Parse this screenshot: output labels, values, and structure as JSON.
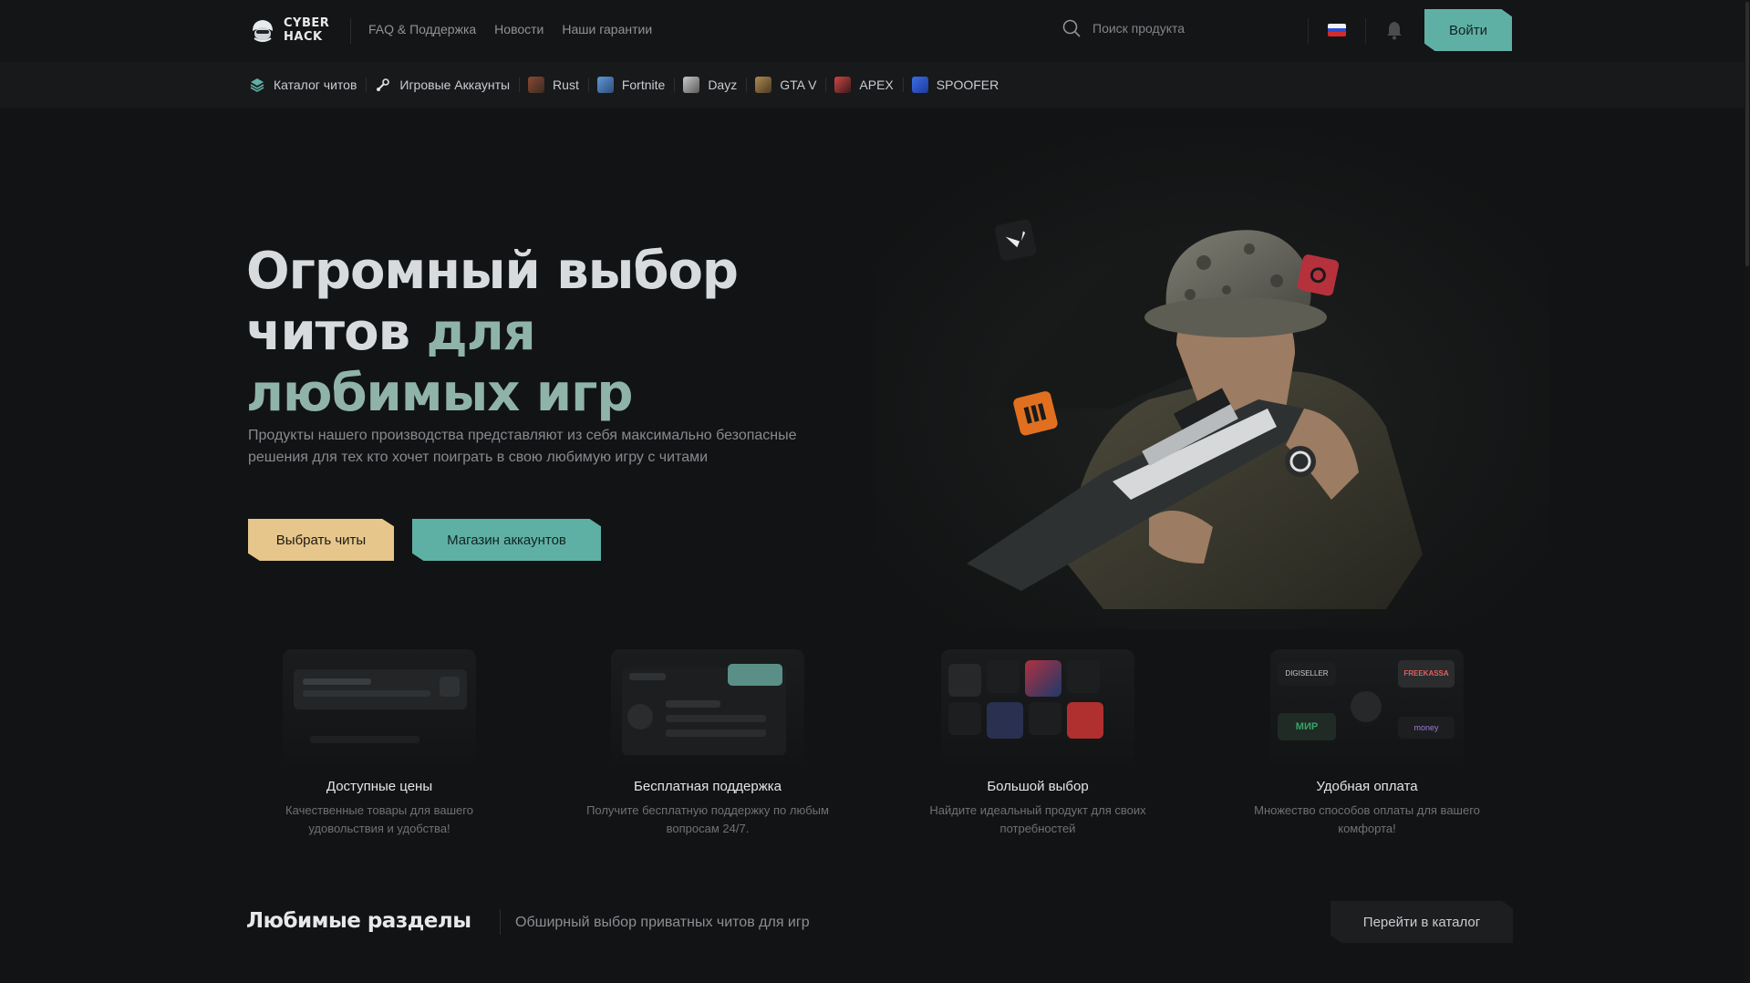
{
  "brand": {
    "line1": "CYBER",
    "line2": "HACK"
  },
  "topnav": [
    {
      "label": "FAQ & Поддержка"
    },
    {
      "label": "Новости"
    },
    {
      "label": "Наши гарантии"
    }
  ],
  "search": {
    "placeholder": "Поиск продукта"
  },
  "header": {
    "login_label": "Войти",
    "language_flag": "ru-flag-icon"
  },
  "catnav": [
    {
      "label": "Каталог читов",
      "icon": "layers-icon",
      "color": "#5fb0a4"
    },
    {
      "label": "Игровые Аккаунты",
      "icon": "steam-icon",
      "color": "#e0e0e0"
    },
    {
      "label": "Rust",
      "icon": "rust-icon",
      "color": "#7a3d2a"
    },
    {
      "label": "Fortnite",
      "icon": "fortnite-icon",
      "color": "#4a7fb8"
    },
    {
      "label": "Dayz",
      "icon": "dayz-icon",
      "color": "#9a9a9a"
    },
    {
      "label": "GTA V",
      "icon": "gta-icon",
      "color": "#8a6b3e"
    },
    {
      "label": "APEX",
      "icon": "apex-icon",
      "color": "#b03a3a"
    },
    {
      "label": "SPOOFER",
      "icon": "spoofer-icon",
      "color": "#2f5fd0"
    }
  ],
  "hero": {
    "title_line1": "Огромный выбор",
    "title_line2a": "читов ",
    "title_line2b": "для",
    "title_line3": "любимых игр",
    "subtitle": "Продукты нашего производства представляют из себя максимально безопасные решения для тех кто хочет поиграть в свою любимую игру с читами",
    "btn_primary": "Выбрать читы",
    "btn_secondary": "Магазин аккаунтов"
  },
  "features": [
    {
      "title": "Доступные цены",
      "desc": "Качественные товары для вашего удовольствия и удобства!"
    },
    {
      "title": "Бесплатная поддержка",
      "desc": "Получите бесплатную поддержку по любым вопросам 24/7."
    },
    {
      "title": "Большой выбор",
      "desc": "Найдите идеальный продукт для своих потребностей"
    },
    {
      "title": "Удобная оплата",
      "desc": "Множество способов оплаты для вашего комфорта!"
    }
  ],
  "payments": {
    "digiseller": "DIGISELLER",
    "freekassa": "FREEKASSA",
    "mir": "МИР",
    "yoomoney": "money"
  },
  "favorites": {
    "title": "Любимые разделы",
    "subtitle": "Обширный выбор приватных читов для игр",
    "catalog_button": "Перейти в каталог"
  },
  "colors": {
    "accent_teal": "#5fb0a4",
    "accent_gold": "#e6c68a",
    "title_accent": "#8fb3a9",
    "background": "#121314"
  }
}
